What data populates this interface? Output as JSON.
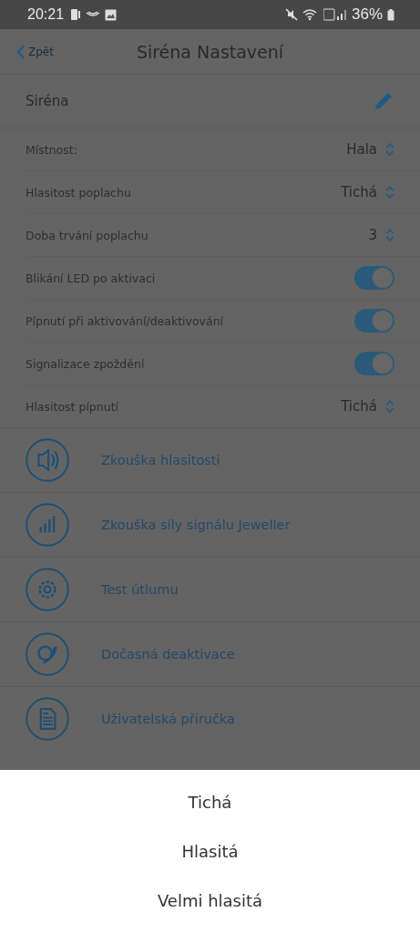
{
  "status_bar": {
    "time": "20:21",
    "battery": "36%"
  },
  "nav": {
    "back": "Zpět",
    "title": "Siréna Nastavení"
  },
  "device": {
    "name": "Siréna"
  },
  "settings": [
    {
      "kind": "select",
      "label": "Místnost:",
      "value": "Hala"
    },
    {
      "kind": "select",
      "label": "Hlasitost poplachu",
      "value": "Tichá"
    },
    {
      "kind": "select",
      "label": "Doba trvání poplachu",
      "value": "3"
    },
    {
      "kind": "toggle",
      "label": "Blikání LED po aktivaci",
      "on": true
    },
    {
      "kind": "toggle",
      "label": "Pípnutí při aktivování/deaktivování",
      "on": true
    },
    {
      "kind": "toggle",
      "label": "Signalizace zpoždění",
      "on": true
    },
    {
      "kind": "select",
      "label": "Hlasitost pípnutí",
      "value": "Tichá"
    }
  ],
  "actions": [
    {
      "label": "Zkouška hlasitosti"
    },
    {
      "label": "Zkouška síly signálu Jeweller"
    },
    {
      "label": "Test útlumu"
    },
    {
      "label": "Dočasná deaktivace"
    },
    {
      "label": "Uživatelská příručka"
    }
  ],
  "sheet": {
    "options": [
      "Tichá",
      "Hlasitá",
      "Velmi hlasitá"
    ]
  }
}
